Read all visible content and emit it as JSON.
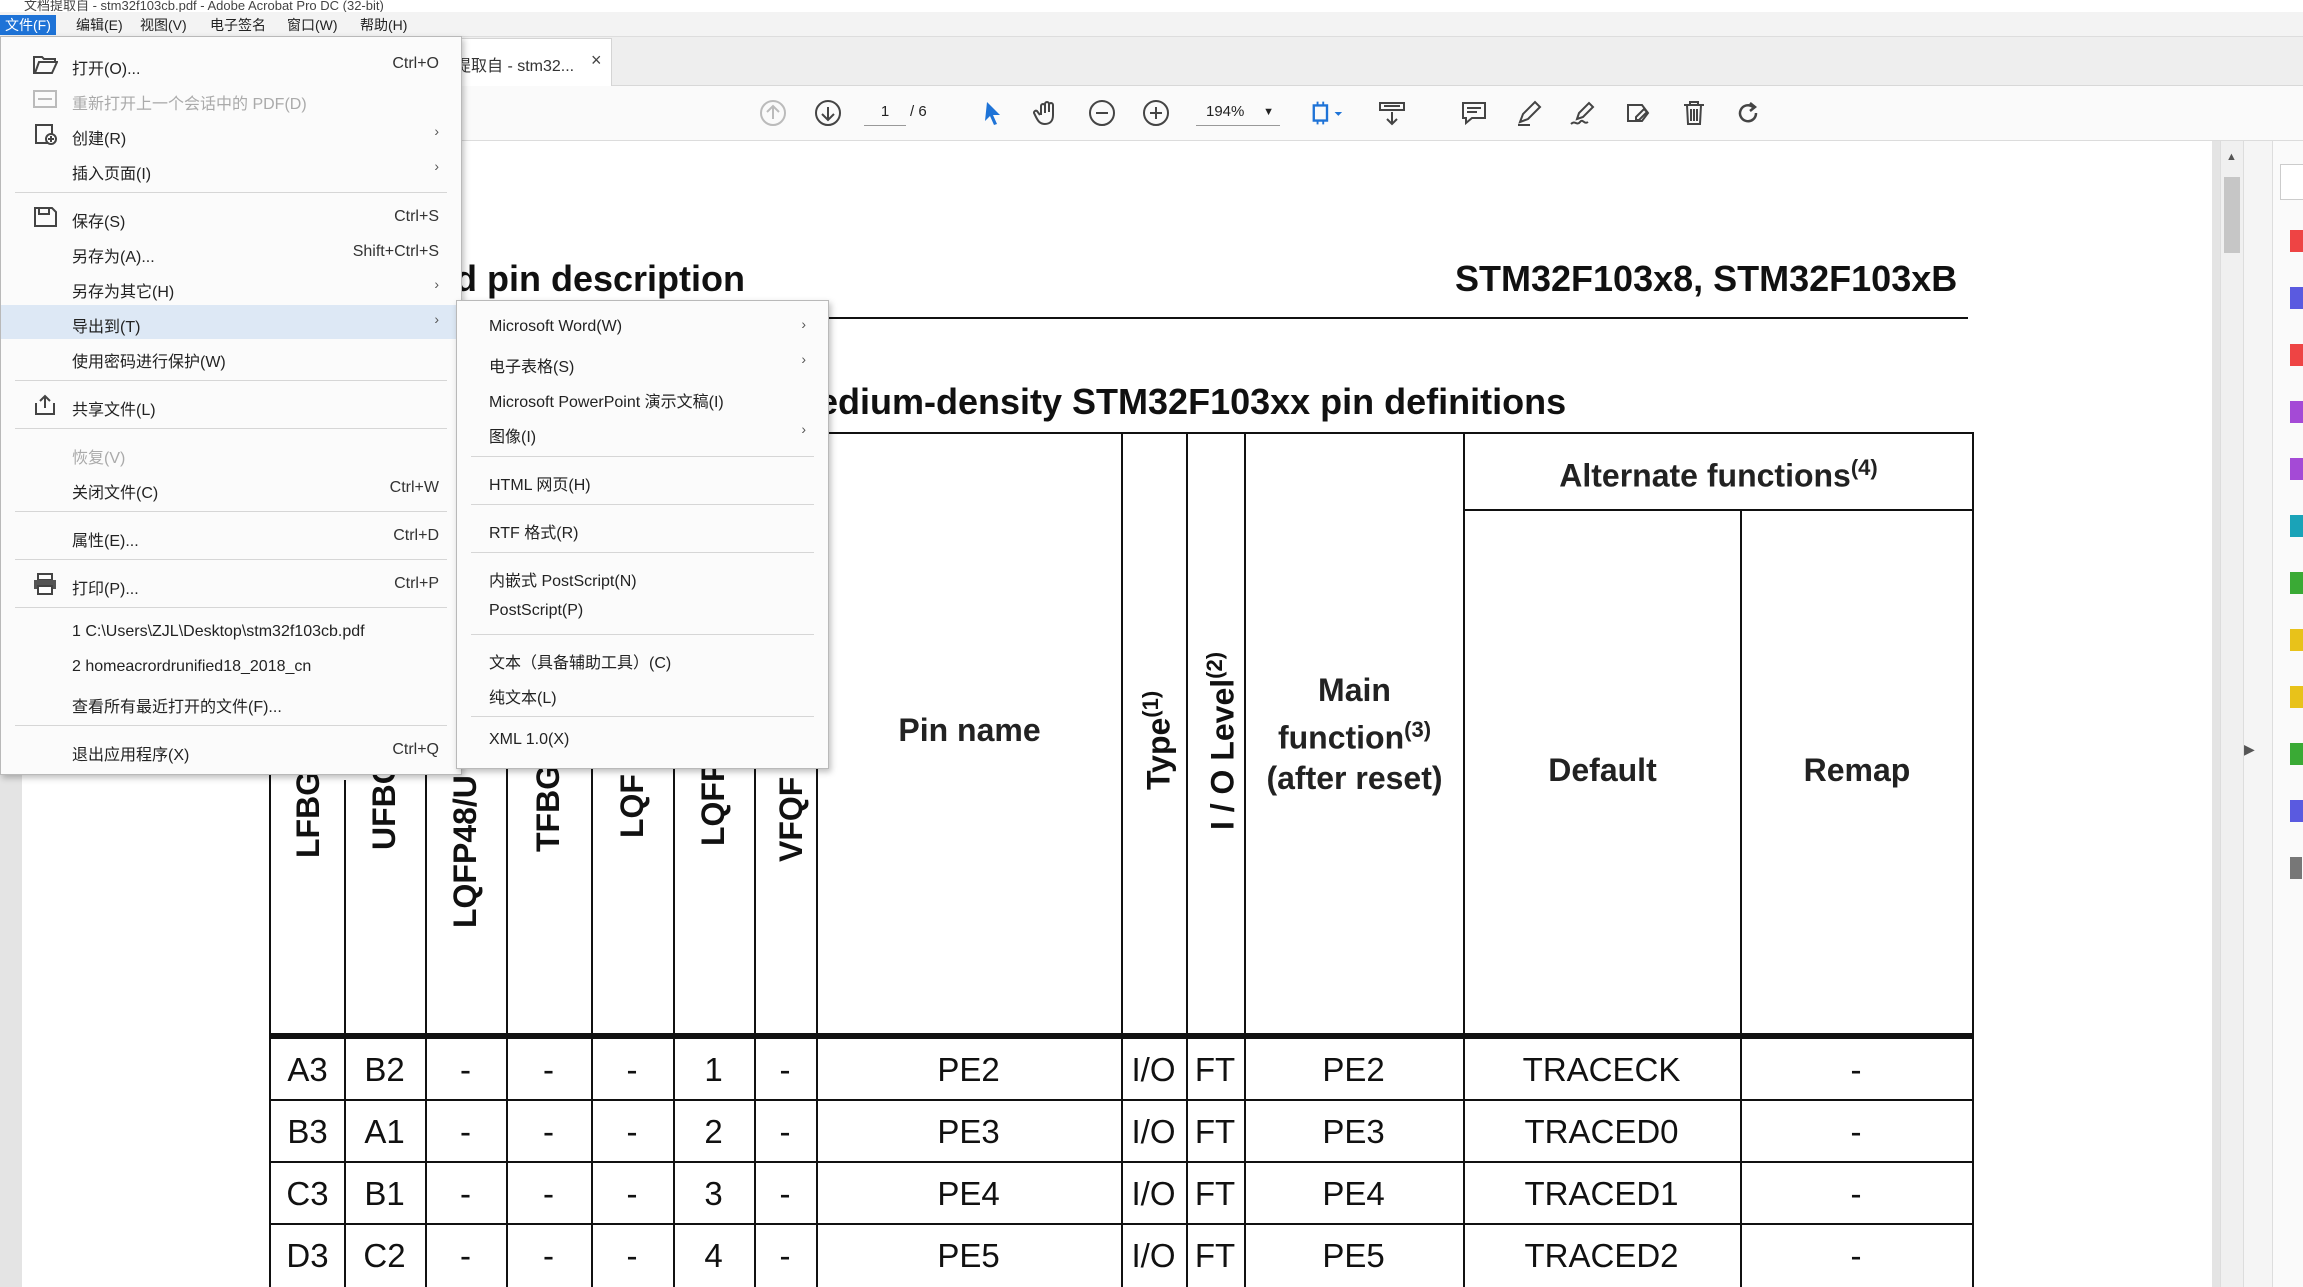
{
  "window": {
    "title": "文档提取自 - stm32f103cb.pdf - Adobe Acrobat Pro DC (32-bit)"
  },
  "menubar": [
    "文件(F)",
    "编辑(E)",
    "视图(V)",
    "电子签名",
    "窗口(W)",
    "帮助(H)"
  ],
  "tab": {
    "title": "提取自 - stm32...",
    "close": "×"
  },
  "toolbar": {
    "page_current": "1",
    "page_total": "/ 6",
    "zoom": "194%"
  },
  "file_menu": {
    "open": {
      "label": "打开(O)...",
      "shortcut": "Ctrl+O"
    },
    "reopen": {
      "label": "重新打开上一个会话中的 PDF(D)"
    },
    "create": {
      "label": "创建(R)"
    },
    "insert": {
      "label": "插入页面(I)"
    },
    "save": {
      "label": "保存(S)",
      "shortcut": "Ctrl+S"
    },
    "save_as": {
      "label": "另存为(A)...",
      "shortcut": "Shift+Ctrl+S"
    },
    "save_other": {
      "label": "另存为其它(H)"
    },
    "export": {
      "label": "导出到(T)"
    },
    "protect": {
      "label": "使用密码进行保护(W)"
    },
    "share": {
      "label": "共享文件(L)"
    },
    "restore": {
      "label": "恢复(V)"
    },
    "close": {
      "label": "关闭文件(C)",
      "shortcut": "Ctrl+W"
    },
    "properties": {
      "label": "属性(E)...",
      "shortcut": "Ctrl+D"
    },
    "print": {
      "label": "打印(P)...",
      "shortcut": "Ctrl+P"
    },
    "recent1": {
      "label": "1 C:\\Users\\ZJL\\Desktop\\stm32f103cb.pdf"
    },
    "recent2": {
      "label": "2 homeacrordrunified18_2018_cn"
    },
    "recent_all": {
      "label": "查看所有最近打开的文件(F)..."
    },
    "exit": {
      "label": "退出应用程序(X)",
      "shortcut": "Ctrl+Q"
    }
  },
  "export_menu": {
    "word": "Microsoft Word(W)",
    "spreadsheet": "电子表格(S)",
    "powerpoint": "Microsoft PowerPoint 演示文稿(I)",
    "image": "图像(I)",
    "html": "HTML 网页(H)",
    "rtf": "RTF 格式(R)",
    "eps": "内嵌式 PostScript(N)",
    "ps": "PostScript(P)",
    "text_access": "文本（具备辅助工具）(C)",
    "plain_text": "纯文本(L)",
    "xml": "XML 1.0(X)"
  },
  "page": {
    "section_header": "d pin description",
    "product": "STM32F103x8, STM32F103xB",
    "table_title": "edium-density STM32F103xx pin definitions",
    "headers": {
      "pkg": [
        "LFBG",
        "UFBG",
        "LQFP48/U",
        "TFBG",
        "LQF",
        "LQFP",
        "VFQF"
      ],
      "pin_name": "Pin name",
      "type": "Type",
      "type_sup": "(1)",
      "io_level": "I / O Level",
      "io_level_sup": "(2)",
      "main1": "Main",
      "main2": "function",
      "main2_sup": "(3)",
      "main3": "(after reset)",
      "alt": "Alternate functions",
      "alt_sup": "(4)",
      "default": "Default",
      "remap": "Remap"
    },
    "rows": [
      [
        "A3",
        "B2",
        "-",
        "-",
        "-",
        "1",
        "-",
        "PE2",
        "I/O",
        "FT",
        "PE2",
        "TRACECK",
        "-"
      ],
      [
        "B3",
        "A1",
        "-",
        "-",
        "-",
        "2",
        "-",
        "PE3",
        "I/O",
        "FT",
        "PE3",
        "TRACED0",
        "-"
      ],
      [
        "C3",
        "B1",
        "-",
        "-",
        "-",
        "3",
        "-",
        "PE4",
        "I/O",
        "FT",
        "PE4",
        "TRACED1",
        "-"
      ],
      [
        "D3",
        "C2",
        "-",
        "-",
        "-",
        "4",
        "-",
        "PE5",
        "I/O",
        "FT",
        "PE5",
        "TRACED2",
        "-"
      ]
    ]
  },
  "colors": {
    "accent": "#1e73d7",
    "highlight": "#dde8f5",
    "annotation": "#e8101e"
  }
}
